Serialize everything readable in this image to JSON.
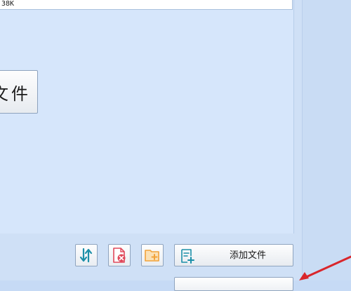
{
  "size_bar": {
    "text": "38K"
  },
  "big_button": {
    "label": "文件"
  },
  "toolbar": {
    "sort_icon": "sort-arrows-icon",
    "delete_icon": "delete-file-icon",
    "add_folder_icon": "add-folder-icon",
    "add_file_icon": "add-file-icon",
    "add_file_label": "添加文件"
  },
  "colors": {
    "background": "#d6e6fb",
    "accent_teal": "#1b8fa8",
    "delete_red": "#e0485a",
    "folder_orange": "#f2a23a",
    "arrow_red": "#d9262b"
  }
}
